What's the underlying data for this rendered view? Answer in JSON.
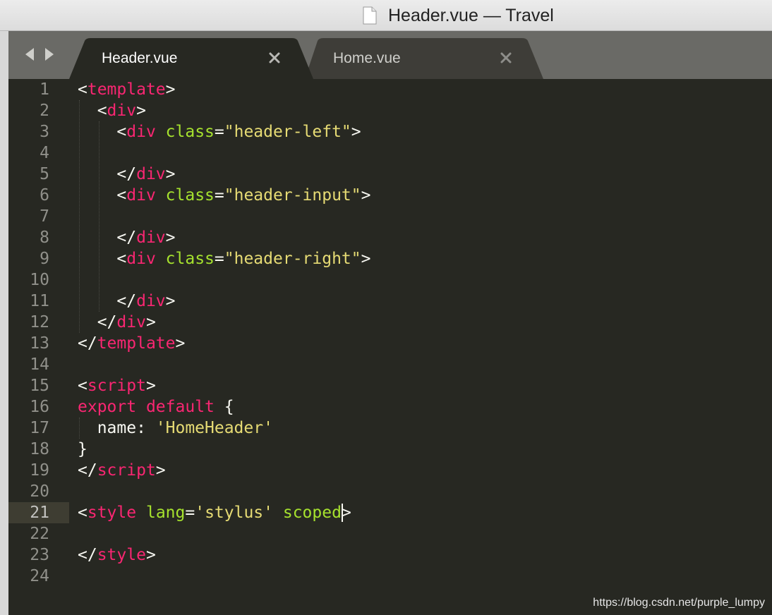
{
  "window": {
    "title": "Header.vue — Travel",
    "file_icon": "document-icon"
  },
  "navigation": {
    "back_icon": "triangle-left-icon",
    "forward_icon": "triangle-right-icon"
  },
  "tabs": [
    {
      "label": "Header.vue",
      "active": true,
      "close_glyph": "×"
    },
    {
      "label": "Home.vue",
      "active": false,
      "close_glyph": "×"
    }
  ],
  "editor": {
    "theme": "Monokai",
    "active_line": 21,
    "colors": {
      "background": "#272822",
      "tag": "#f92672",
      "attribute": "#a6e22e",
      "string": "#e6db74",
      "keyword": "#f92672",
      "text": "#f8f8f2",
      "gutter_text": "#90908a"
    },
    "lines": [
      {
        "number": "1",
        "tokens": [
          [
            "tx",
            "<"
          ],
          [
            "tg",
            "template"
          ],
          [
            "tx",
            ">"
          ]
        ]
      },
      {
        "number": "2",
        "tokens": [
          [
            "tx",
            "  <"
          ],
          [
            "tg",
            "div"
          ],
          [
            "tx",
            ">"
          ]
        ]
      },
      {
        "number": "3",
        "tokens": [
          [
            "tx",
            "    <"
          ],
          [
            "tg",
            "div"
          ],
          [
            "tx",
            " "
          ],
          [
            "at",
            "class"
          ],
          [
            "tx",
            "="
          ],
          [
            "st",
            "\"header-left\""
          ],
          [
            "tx",
            ">"
          ]
        ]
      },
      {
        "number": "4",
        "tokens": []
      },
      {
        "number": "5",
        "tokens": [
          [
            "tx",
            "    </"
          ],
          [
            "tg",
            "div"
          ],
          [
            "tx",
            ">"
          ]
        ]
      },
      {
        "number": "6",
        "tokens": [
          [
            "tx",
            "    <"
          ],
          [
            "tg",
            "div"
          ],
          [
            "tx",
            " "
          ],
          [
            "at",
            "class"
          ],
          [
            "tx",
            "="
          ],
          [
            "st",
            "\"header-input\""
          ],
          [
            "tx",
            ">"
          ]
        ]
      },
      {
        "number": "7",
        "tokens": []
      },
      {
        "number": "8",
        "tokens": [
          [
            "tx",
            "    </"
          ],
          [
            "tg",
            "div"
          ],
          [
            "tx",
            ">"
          ]
        ]
      },
      {
        "number": "9",
        "tokens": [
          [
            "tx",
            "    <"
          ],
          [
            "tg",
            "div"
          ],
          [
            "tx",
            " "
          ],
          [
            "at",
            "class"
          ],
          [
            "tx",
            "="
          ],
          [
            "st",
            "\"header-right\""
          ],
          [
            "tx",
            ">"
          ]
        ]
      },
      {
        "number": "10",
        "tokens": []
      },
      {
        "number": "11",
        "tokens": [
          [
            "tx",
            "    </"
          ],
          [
            "tg",
            "div"
          ],
          [
            "tx",
            ">"
          ]
        ]
      },
      {
        "number": "12",
        "tokens": [
          [
            "tx",
            "  </"
          ],
          [
            "tg",
            "div"
          ],
          [
            "tx",
            ">"
          ]
        ]
      },
      {
        "number": "13",
        "tokens": [
          [
            "tx",
            "</"
          ],
          [
            "tg",
            "template"
          ],
          [
            "tx",
            ">"
          ]
        ]
      },
      {
        "number": "14",
        "tokens": []
      },
      {
        "number": "15",
        "tokens": [
          [
            "tx",
            "<"
          ],
          [
            "tg",
            "script"
          ],
          [
            "tx",
            ">"
          ]
        ]
      },
      {
        "number": "16",
        "tokens": [
          [
            "kw",
            "export"
          ],
          [
            "tx",
            " "
          ],
          [
            "kw",
            "default"
          ],
          [
            "tx",
            " {"
          ]
        ]
      },
      {
        "number": "17",
        "tokens": [
          [
            "tx",
            "  name: "
          ],
          [
            "st",
            "'HomeHeader'"
          ]
        ]
      },
      {
        "number": "18",
        "tokens": [
          [
            "tx",
            "}"
          ]
        ]
      },
      {
        "number": "19",
        "tokens": [
          [
            "tx",
            "</"
          ],
          [
            "tg",
            "script"
          ],
          [
            "tx",
            ">"
          ]
        ]
      },
      {
        "number": "20",
        "tokens": []
      },
      {
        "number": "21",
        "tokens": [
          [
            "tx",
            "<"
          ],
          [
            "tg",
            "style"
          ],
          [
            "tx",
            " "
          ],
          [
            "at",
            "lang"
          ],
          [
            "tx",
            "="
          ],
          [
            "st",
            "'stylus'"
          ],
          [
            "tx",
            " "
          ],
          [
            "at",
            "scoped"
          ],
          [
            "tx",
            ">"
          ]
        ]
      },
      {
        "number": "22",
        "tokens": []
      },
      {
        "number": "23",
        "tokens": [
          [
            "tx",
            "</"
          ],
          [
            "tg",
            "style"
          ],
          [
            "tx",
            ">"
          ]
        ]
      },
      {
        "number": "24",
        "tokens": []
      }
    ]
  },
  "watermark": "https://blog.csdn.net/purple_lumpy"
}
